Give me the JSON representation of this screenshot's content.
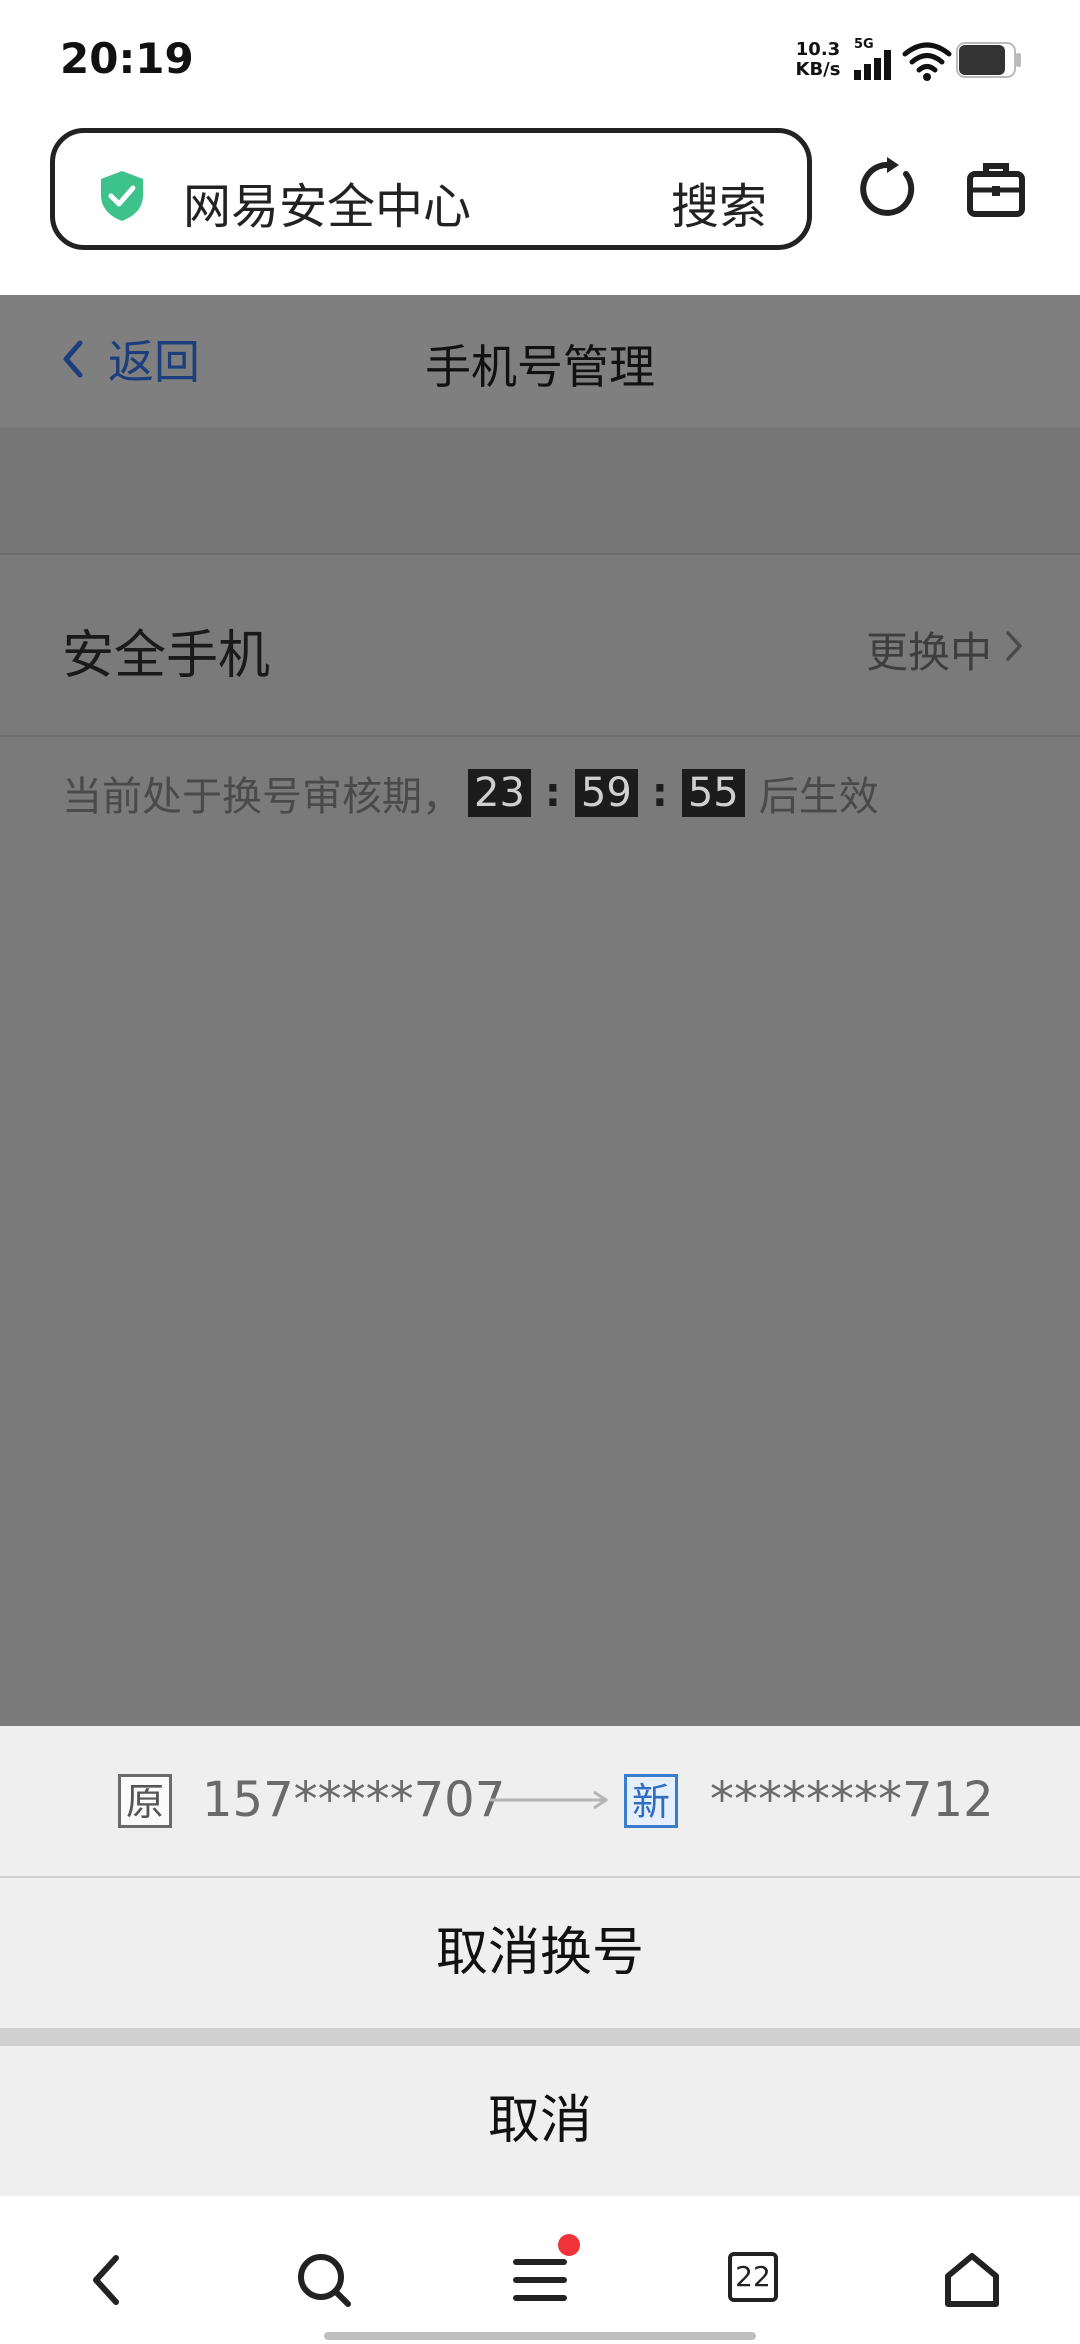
{
  "status_bar": {
    "time": "20:19",
    "net_speed_value": "10.3",
    "net_speed_unit": "KB/s",
    "network": "5G"
  },
  "browser": {
    "url_title": "网易安全中心",
    "search_label": "搜索",
    "shield_color": "#3cc28a"
  },
  "header": {
    "back_label": "返回",
    "title": "手机号管理"
  },
  "phone_row": {
    "label": "安全手机",
    "status": "更换中"
  },
  "countdown": {
    "prefix": "当前处于换号审核期，",
    "hours": "23",
    "minutes": "59",
    "seconds": "55",
    "separator": ":",
    "suffix": "后生效"
  },
  "sheet": {
    "old_tag": "原",
    "old_number": "157*****707",
    "new_tag": "新",
    "new_number": "********712",
    "cancel_change_label": "取消换号",
    "cancel_label": "取消"
  },
  "bottom_nav": {
    "tab_count": "22",
    "badge_color": "#f0333a"
  }
}
